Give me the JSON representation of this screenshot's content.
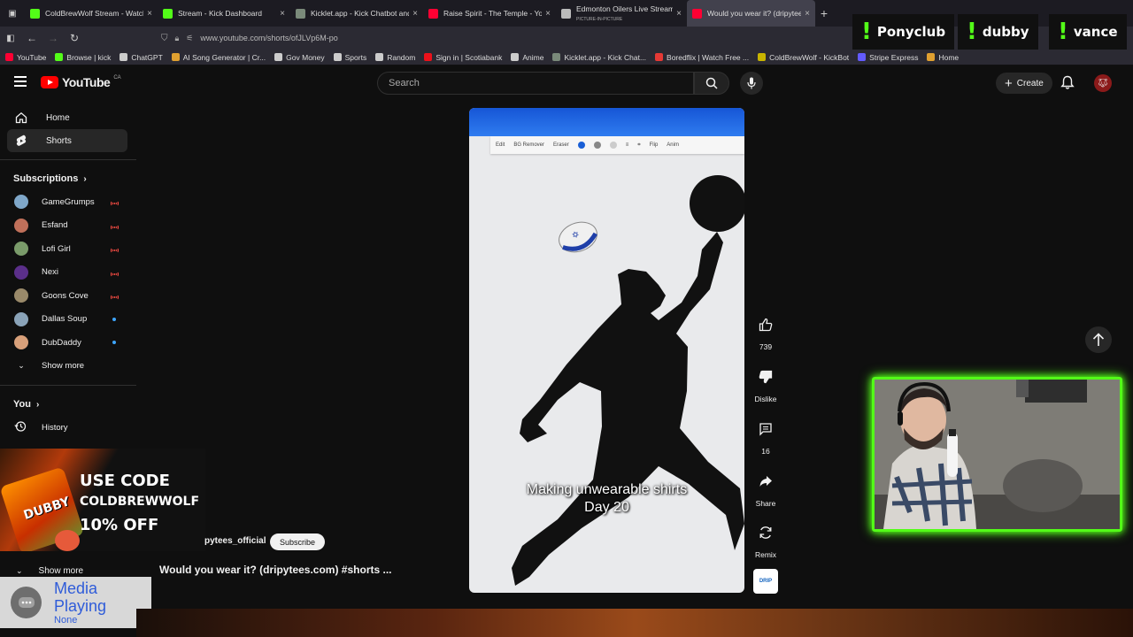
{
  "browser": {
    "tabs": [
      {
        "title": "ColdBrewWolf Stream - Watch Liv",
        "favicon_color": "#53fc18",
        "active": false
      },
      {
        "title": "Stream - Kick Dashboard",
        "favicon_color": "#53fc18",
        "active": false
      },
      {
        "title": "Kicklet.app - Kick Chatbot and ...",
        "favicon_color": "#7a8a7a",
        "active": false
      },
      {
        "title": "Raise Spirit - The Temple - YouT",
        "favicon_color": "#ff0033",
        "active": false
      },
      {
        "title": "Edmonton Oilers Live Stream -",
        "subtitle": "PICTURE-IN-PICTURE",
        "favicon_color": "#bbbbbb",
        "active": false
      },
      {
        "title": "Would you wear it? (dripytees.",
        "favicon_color": "#ff0033",
        "active": true
      }
    ],
    "url": "www.youtube.com/shorts/ofJLVp6M-po",
    "bookmarks": [
      {
        "label": "YouTube",
        "color": "#ff0033"
      },
      {
        "label": "Browse | kick",
        "color": "#53fc18"
      },
      {
        "label": "ChatGPT",
        "color": "#cccccc"
      },
      {
        "label": "AI Song Generator | Cr...",
        "color": "#e0a030"
      },
      {
        "label": "Gov Money",
        "color": "#cccccc"
      },
      {
        "label": "Sports",
        "color": "#cccccc"
      },
      {
        "label": "Random",
        "color": "#cccccc"
      },
      {
        "label": "Sign in | Scotiabank",
        "color": "#ec111a"
      },
      {
        "label": "Anime",
        "color": "#cccccc"
      },
      {
        "label": "Kicklet.app - Kick Chat...",
        "color": "#7a8a7a"
      },
      {
        "label": "Boredflix | Watch Free ...",
        "color": "#e53935"
      },
      {
        "label": "ColdBrewWolf - KickBot",
        "color": "#c8b400"
      },
      {
        "label": "Stripe Express",
        "color": "#635bff"
      },
      {
        "label": "Home",
        "color": "#e0a030"
      }
    ]
  },
  "overlay_commands": [
    "Ponyclub",
    "dubby",
    "vance"
  ],
  "yt": {
    "logo_text": "YouTube",
    "logo_country": "CA",
    "search_placeholder": "Search",
    "create_label": "Create",
    "sidebar": {
      "main": [
        {
          "label": "Home",
          "icon": "home-icon",
          "active": false
        },
        {
          "label": "Shorts",
          "icon": "shorts-icon",
          "active": true
        }
      ],
      "subscriptions_heading": "Subscriptions",
      "subscriptions": [
        {
          "name": "GameGrumps",
          "avatar_color": "#7fa7c9",
          "status": "live"
        },
        {
          "name": "Esfand",
          "avatar_color": "#c0705a",
          "status": "live"
        },
        {
          "name": "Lofi Girl",
          "avatar_color": "#7a9b6a",
          "status": "live"
        },
        {
          "name": "Nexi",
          "avatar_color": "#5b2f8a",
          "status": "live"
        },
        {
          "name": "Goons Cove",
          "avatar_color": "#9a8a6a",
          "status": "live"
        },
        {
          "name": "Dallas Soup",
          "avatar_color": "#8aa3b8",
          "status": "new"
        },
        {
          "name": "DubDaddy",
          "avatar_color": "#d8a07a",
          "status": "new"
        }
      ],
      "show_more": "Show more",
      "you_heading": "You",
      "history": "History",
      "show_more_2": "Show more"
    },
    "short": {
      "caption_line1": "Making unwearable shirts",
      "caption_line2": "Day 20",
      "toolbar_items": [
        "Edit",
        "BG Remover",
        "Eraser",
        "Flip",
        "Anim"
      ]
    },
    "actions": {
      "likes": "739",
      "dislike_label": "Dislike",
      "comments": "16",
      "share_label": "Share",
      "remix_label": "Remix"
    },
    "channel": {
      "name": "pytees_official",
      "subscribe_label": "Subscribe"
    },
    "video_title": "Would you wear it? (dripytees.com) #shorts ..."
  },
  "promo": {
    "brand": "DUBBY",
    "line1": "USE CODE",
    "line2": "COLDBREWWOLF",
    "line3": "10% OFF"
  },
  "media_widget": {
    "title": "Media Playing",
    "subtitle": "None"
  }
}
